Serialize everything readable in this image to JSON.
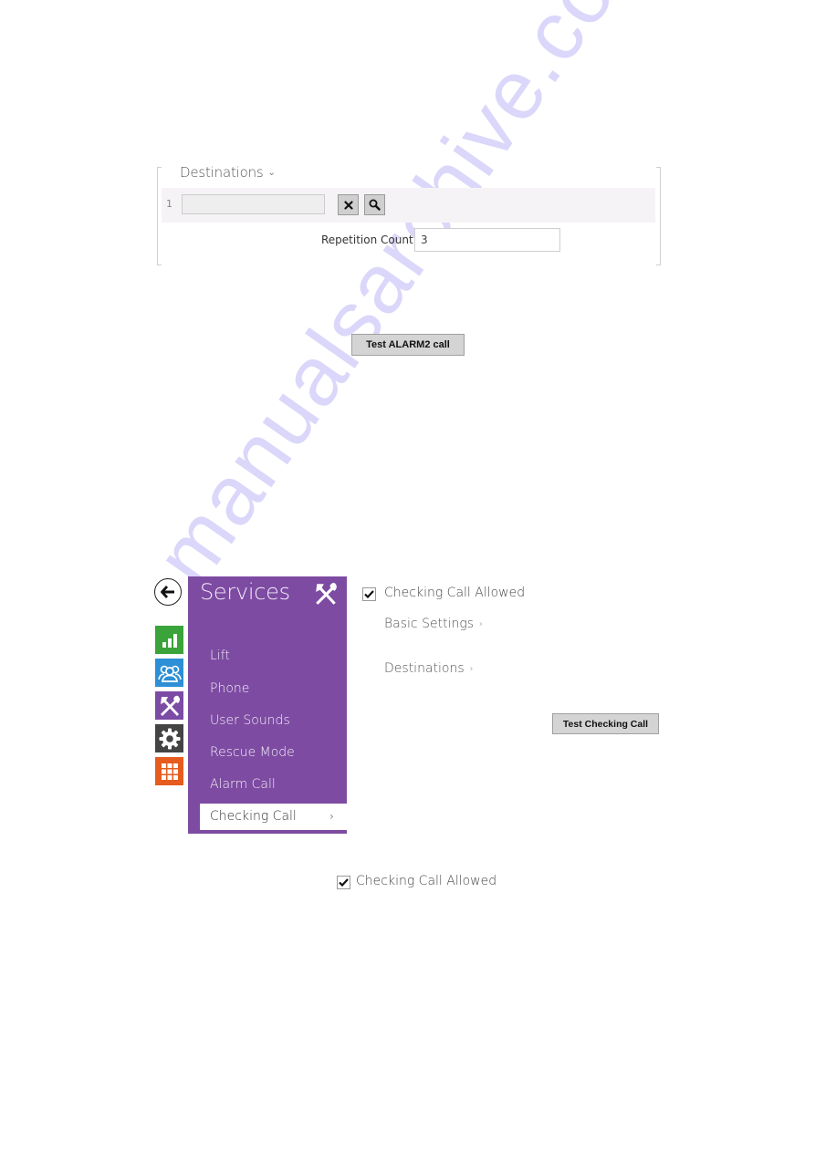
{
  "destinations_panel": {
    "title": "Destinations",
    "title_chevron": "⌄",
    "rows": [
      {
        "index": "1",
        "value": "",
        "clear_icon": "close-icon",
        "search_icon": "search-icon"
      }
    ],
    "repetition_count_label": "Repetition Count",
    "repetition_count_value": "3"
  },
  "test_alarm_button": "Test ALARM2 call",
  "nav": {
    "back_icon": "arrow-left-icon",
    "tiles": [
      {
        "name": "status",
        "icon": "bar-chart-icon",
        "color": "#3aa33a"
      },
      {
        "name": "directory",
        "icon": "users-icon",
        "color": "#2d8fd5"
      },
      {
        "name": "services",
        "icon": "hammer-wrench-icon",
        "color": "#7c4ba4"
      },
      {
        "name": "hardware",
        "icon": "gear-icon",
        "color": "#444444"
      },
      {
        "name": "system",
        "icon": "grid-icon",
        "color": "#e55c1e"
      }
    ]
  },
  "services_menu": {
    "title": "Services",
    "accent_color": "#7d4ba2",
    "items": [
      {
        "label": "Lift",
        "selected": false
      },
      {
        "label": "Phone",
        "selected": false
      },
      {
        "label": "User Sounds",
        "selected": false
      },
      {
        "label": "Rescue Mode",
        "selected": false
      },
      {
        "label": "Alarm Call",
        "selected": false
      },
      {
        "label": "Checking Call",
        "selected": true,
        "arrow": "›"
      }
    ]
  },
  "checking_call": {
    "allowed_label": "Checking Call Allowed",
    "allowed_checked": true,
    "basic_settings_label": "Basic Settings",
    "destinations_label": "Destinations",
    "link_chevron": "›",
    "test_button": "Test Checking Call"
  },
  "standalone_checkbox": {
    "label": "Checking Call Allowed",
    "checked": true
  },
  "watermark": "manualsarchive.com"
}
